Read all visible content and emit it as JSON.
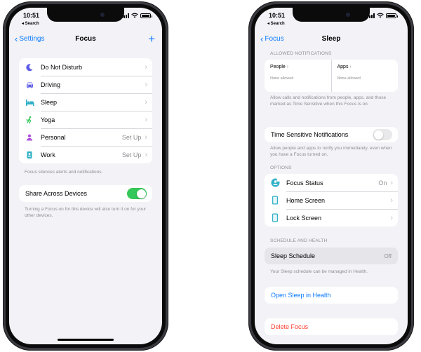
{
  "status": {
    "time": "10:51",
    "back_app": "◂ Search"
  },
  "left": {
    "back_label": "Settings",
    "title": "Focus",
    "plus": "+",
    "focus_items": [
      {
        "label": "Do Not Disturb",
        "value": "",
        "icon": "moon-icon",
        "color": "#5e5ce6"
      },
      {
        "label": "Driving",
        "value": "",
        "icon": "car-icon",
        "color": "#5e5ce6"
      },
      {
        "label": "Sleep",
        "value": "",
        "icon": "bed-icon",
        "color": "#30b0c7"
      },
      {
        "label": "Yoga",
        "value": "",
        "icon": "figure-icon",
        "color": "#34c759"
      },
      {
        "label": "Personal",
        "value": "Set Up",
        "icon": "person-icon",
        "color": "#af52de"
      },
      {
        "label": "Work",
        "value": "Set Up",
        "icon": "badge-icon",
        "color": "#30b0c7"
      }
    ],
    "focus_footnote": "Focus silences alerts and notifications.",
    "share_label": "Share Across Devices",
    "share_on": true,
    "share_footnote": "Turning a Focus on for this device will also turn it on for your other devices."
  },
  "right": {
    "back_label": "Focus",
    "title": "Sleep",
    "allowed_header": "Allowed Notifications",
    "people_label": "People",
    "people_sub": "None allowed",
    "apps_label": "Apps",
    "apps_sub": "None allowed",
    "allowed_footnote": "Allow calls and notifications from people, apps, and those marked as Time Sensitive when this Focus is on.",
    "time_sensitive_label": "Time Sensitive Notifications",
    "time_sensitive_on": false,
    "time_sensitive_footnote": "Allow people and apps to notify you immediately, even when you have a Focus turned on.",
    "options_header": "Options",
    "options": [
      {
        "label": "Focus Status",
        "value": "On",
        "icon": "focus-status-icon",
        "color": "#30b0c7"
      },
      {
        "label": "Home Screen",
        "value": "",
        "icon": "phone-home-icon",
        "color": "#30b0c7"
      },
      {
        "label": "Lock Screen",
        "value": "",
        "icon": "phone-lock-icon",
        "color": "#30b0c7"
      }
    ],
    "schedule_header": "Schedule and Health",
    "sleep_schedule_label": "Sleep Schedule",
    "sleep_schedule_value": "Off",
    "schedule_footnote": "Your Sleep schedule can be managed in Health.",
    "open_health_label": "Open Sleep in Health",
    "delete_label": "Delete Focus"
  },
  "colors": {
    "accent": "#0a7aff",
    "switch_on": "#34c759",
    "destructive": "#ff3b30"
  }
}
